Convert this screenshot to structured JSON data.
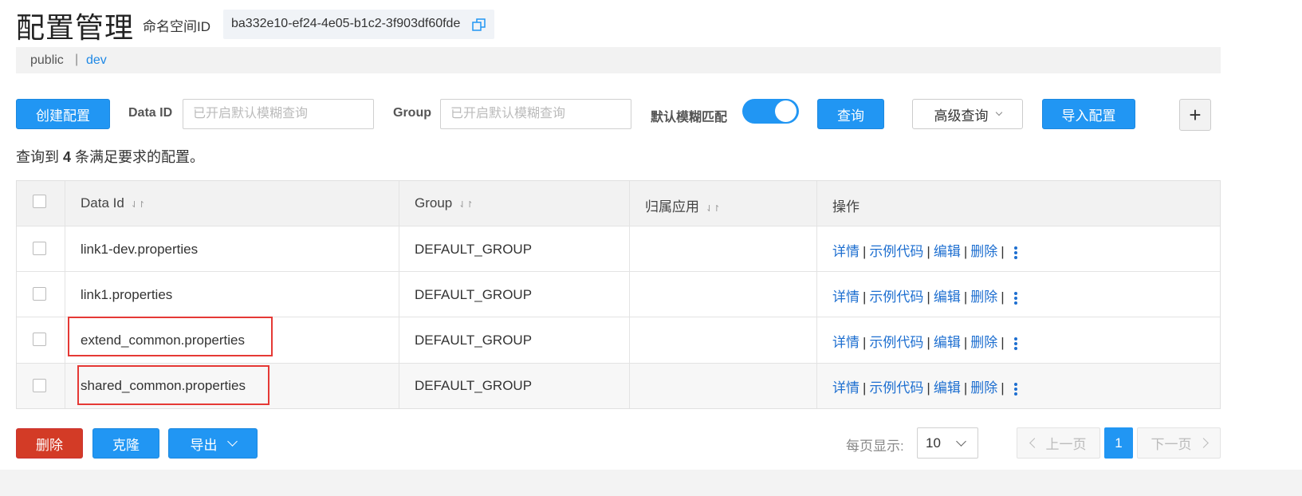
{
  "header": {
    "title": "配置管理",
    "namespace_label": "命名空间ID",
    "namespace_id": "ba332e10-ef24-4e05-b1c2-3f903df60fde"
  },
  "env_tabs": {
    "public": "public",
    "separator": "|",
    "dev": "dev"
  },
  "toolbar": {
    "create_label": "创建配置",
    "dataid_label": "Data ID",
    "dataid_placeholder": "已开启默认模糊查询",
    "group_label": "Group",
    "group_placeholder": "已开启默认模糊查询",
    "fuzzy_label": "默认模糊匹配",
    "fuzzy_enabled": true,
    "query_label": "查询",
    "advanced_label": "高级查询",
    "import_label": "导入配置",
    "add_label": "+"
  },
  "summary": {
    "prefix": "查询到",
    "count": "4",
    "suffix": "条满足要求的配置。"
  },
  "table": {
    "columns": [
      "Data Id",
      "Group",
      "归属应用",
      "操作"
    ],
    "sort_icon": "⇃↾",
    "rows": [
      {
        "data_id": "link1-dev.properties",
        "group": "DEFAULT_GROUP",
        "app": ""
      },
      {
        "data_id": "link1.properties",
        "group": "DEFAULT_GROUP",
        "app": ""
      },
      {
        "data_id": "extend_common.properties",
        "group": "DEFAULT_GROUP",
        "app": ""
      },
      {
        "data_id": "shared_common.properties",
        "group": "DEFAULT_GROUP",
        "app": ""
      }
    ],
    "actions": {
      "detail": "详情",
      "sample": "示例代码",
      "edit": "编辑",
      "delete": "删除",
      "sep": "|"
    }
  },
  "footer": {
    "delete_label": "删除",
    "clone_label": "克隆",
    "export_label": "导出",
    "per_page_label": "每页显示:",
    "per_page_value": "10",
    "prev_label": "上一页",
    "current_page": "1",
    "next_label": "下一页"
  },
  "colors": {
    "primary": "#2196f3",
    "danger": "#d33b26",
    "link": "#1e6fd0",
    "highlight": "#e53935"
  }
}
